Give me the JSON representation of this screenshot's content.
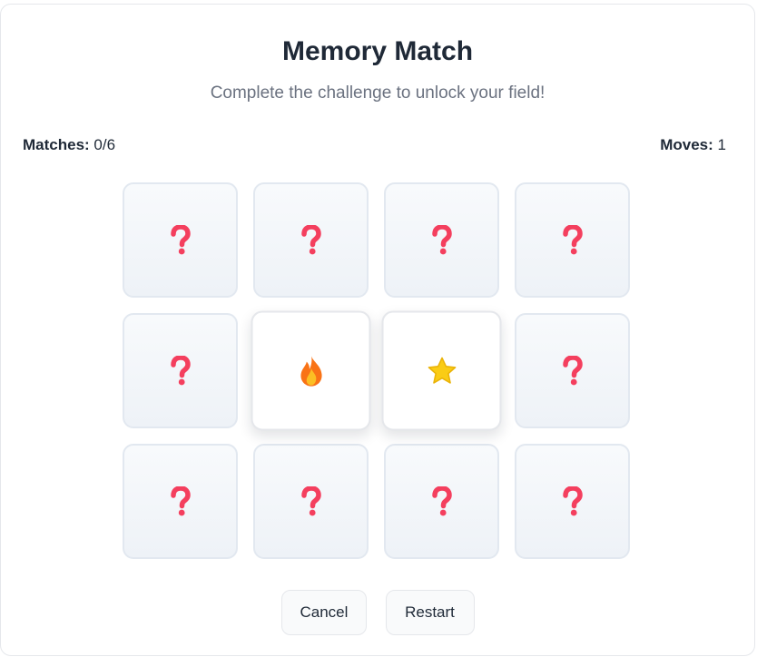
{
  "game": {
    "title": "Memory Match",
    "subtitle": "Complete the challenge to unlock your field!"
  },
  "stats": {
    "matches_label": "Matches:",
    "matches_value": "0/6",
    "moves_label": "Moves:",
    "moves_value": "1"
  },
  "cards": [
    {
      "state": "hidden",
      "icon": "question-mark-icon"
    },
    {
      "state": "hidden",
      "icon": "question-mark-icon"
    },
    {
      "state": "hidden",
      "icon": "question-mark-icon"
    },
    {
      "state": "hidden",
      "icon": "question-mark-icon"
    },
    {
      "state": "hidden",
      "icon": "question-mark-icon"
    },
    {
      "state": "revealed",
      "icon": "fire-icon"
    },
    {
      "state": "revealed",
      "icon": "star-icon"
    },
    {
      "state": "hidden",
      "icon": "question-mark-icon"
    },
    {
      "state": "hidden",
      "icon": "question-mark-icon"
    },
    {
      "state": "hidden",
      "icon": "question-mark-icon"
    },
    {
      "state": "hidden",
      "icon": "question-mark-icon"
    },
    {
      "state": "hidden",
      "icon": "question-mark-icon"
    }
  ],
  "buttons": {
    "cancel_label": "Cancel",
    "restart_label": "Restart"
  },
  "colors": {
    "question_mark": "#f43f5e",
    "fire_outer": "#f97316",
    "fire_inner": "#fbbf24",
    "star": "#facc15",
    "text_primary": "#1f2937",
    "text_secondary": "#6b7280"
  }
}
